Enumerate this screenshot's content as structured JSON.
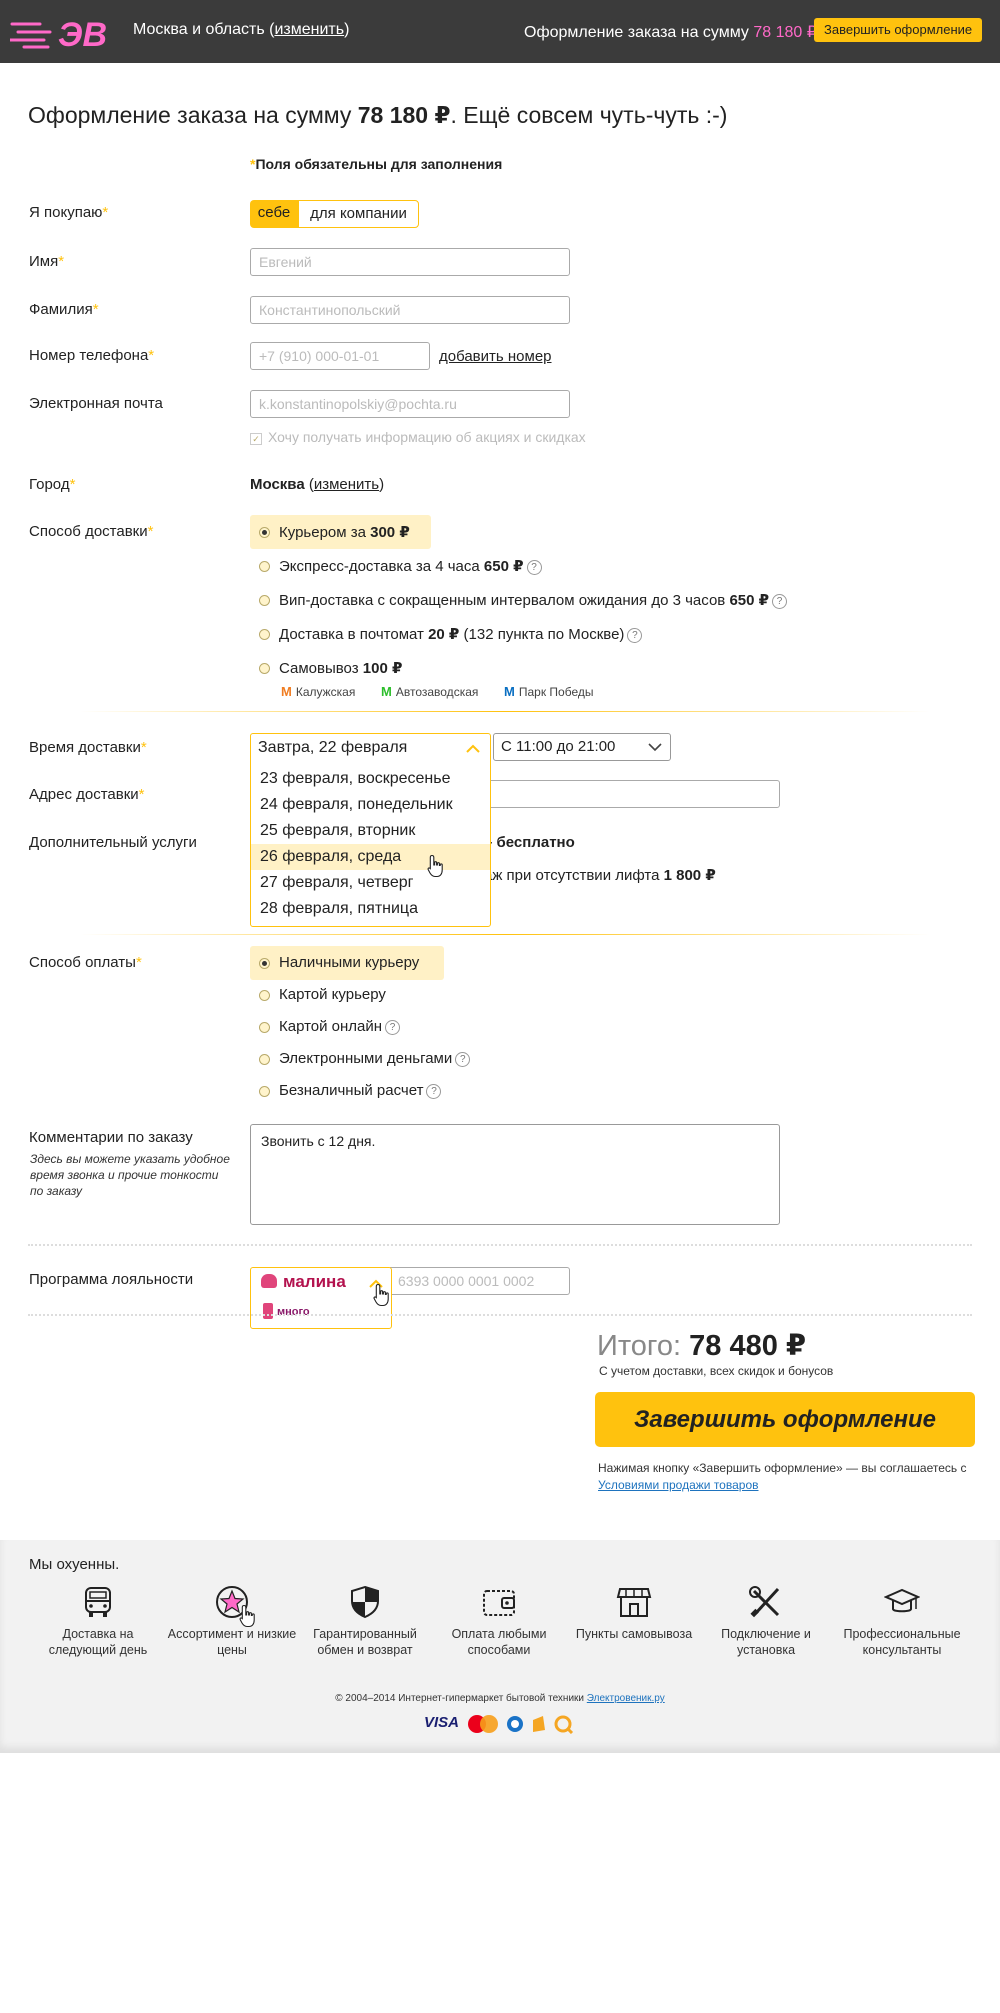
{
  "header": {
    "logo_text": "ЭВ",
    "region_text": "Москва и область",
    "region_change": "изменить",
    "order_sum_label": "Оформление заказа на сумму",
    "order_sum_value": "78 180 ₽",
    "finish_button": "Завершить оформление"
  },
  "title": {
    "prefix": "Оформление заказа на сумму",
    "amount": "78 180 ₽",
    "suffix": ". Ещё совсем чуть-чуть :-)"
  },
  "required_note": "Поля обязательны для заполнения",
  "form": {
    "buyer_label": "Я покупаю",
    "buyer_self": "себе",
    "buyer_company": "для компании",
    "name_label": "Имя",
    "name_placeholder": "Евгений",
    "surname_label": "Фамилия",
    "surname_placeholder": "Константинопольский",
    "phone_label": "Номер телефона",
    "phone_placeholder": "+7 (910) 000-01-01",
    "add_phone": "добавить номер",
    "email_label": "Электронная почта",
    "email_placeholder": "k.konstantinopolskiy@pochta.ru",
    "subscribe_label": "Хочу получать информацию об акциях и скидках",
    "city_label": "Город",
    "city_value": "Москва",
    "city_change": "изменить",
    "delivery_label": "Способ доставки",
    "delivery_options": [
      {
        "text": "Курьером за ",
        "price": "300 ₽",
        "extra": ""
      },
      {
        "text": "Экспресс-доставка за 4 часа ",
        "price": "650 ₽",
        "extra": ""
      },
      {
        "text": "Вип-доставка с сокращенным интервалом ожидания до 3 часов ",
        "price": "650 ₽",
        "extra": ""
      },
      {
        "text": "Доставка в почтомат ",
        "price": "20 ₽",
        "extra": " (132 пункта по Москве)"
      },
      {
        "text": "Самовывоз ",
        "price": "100 ₽",
        "extra": ""
      }
    ],
    "metro": [
      "Калужская",
      "Автозаводская",
      "Парк Победы"
    ],
    "delivery_time_label": "Время доставки",
    "delivery_date_selected": "Завтра, 22 февраля",
    "delivery_dates": [
      "23 февраля, воскресенье",
      "24 февраля, понедельник",
      "25 февраля, вторник",
      "26 февраля, среда",
      "27 февраля, четверг",
      "28 февраля, пятница"
    ],
    "delivery_interval": "С 11:00 до 21:00",
    "address_label": "Адрес доставки",
    "services_label": "Дополнительный услуги",
    "services_free": "бесплатно",
    "services_lift_text": "аж при отсутствии лифта",
    "services_lift_price": "1 800 ₽",
    "payment_label": "Способ оплаты",
    "payment_options": [
      "Наличными курьеру",
      "Картой курьеру",
      "Картой онлайн",
      "Электронными деньгами",
      "Безналичный расчет"
    ],
    "comment_label": "Комментарии по заказу",
    "comment_hint": "Здесь вы можете указать удобное время звонка и прочие тонкости по заказу",
    "comment_value": "Звонить с 12 дня.",
    "loyalty_label": "Программа лояльности",
    "loyalty_selected": "малина",
    "loyalty_other": "много",
    "loyalty_placeholder": "6393 0000 0001 0002"
  },
  "summary": {
    "total_word": "Итого:",
    "total_value": "78 480 ₽",
    "total_sub": "С учетом доставки, всех скидок и бонусов",
    "finish_button": "Завершить оформление",
    "agree_text": "Нажимая кнопку «Завершить оформление» — вы соглашаетесь с",
    "agree_link": "Условиями продажи товаров"
  },
  "footer": {
    "tagline": "Мы охуенны.",
    "features": [
      "Доставка на следующий день",
      "Ассортимент и низкие цены",
      "Гарантированный обмен и возврат",
      "Оплата любыми способами",
      "Пункты самовывоза",
      "Подключение и установка",
      "Профессиональные консультанты"
    ],
    "copyright": "© 2004–2014 Интернет-гипермаркет бытовой техники",
    "copyright_link": "Электровеник.ру",
    "payments": [
      "VISA",
      "MasterCard",
      "WebMoney",
      "Яндекс.Деньги",
      "QIWI"
    ]
  },
  "colors": {
    "accent": "#ffc20e",
    "brand_pink": "#ff69c8",
    "header_bg": "#3b3b3b",
    "highlight": "#fff1c6"
  }
}
